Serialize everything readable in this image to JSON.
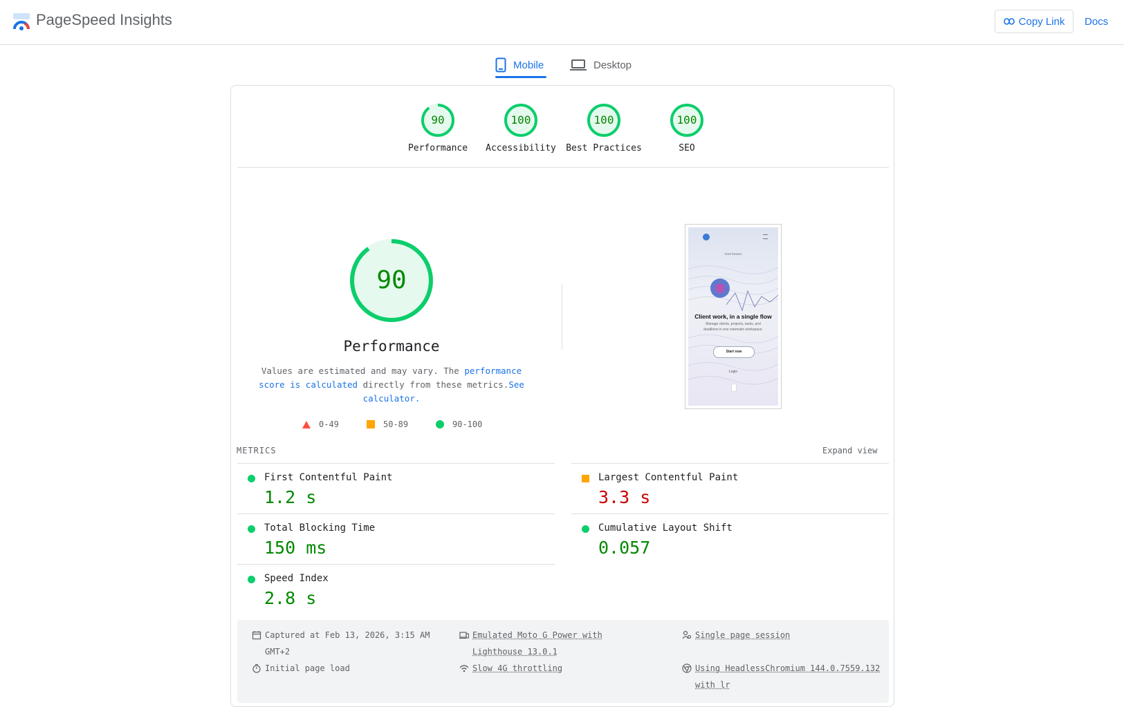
{
  "header": {
    "title": "PageSpeed Insights",
    "copy_link": "Copy Link",
    "docs": "Docs"
  },
  "tabs": [
    {
      "label": "Mobile",
      "selected": true
    },
    {
      "label": "Desktop",
      "selected": false
    }
  ],
  "category_scores": [
    {
      "label": "Performance",
      "score": "90"
    },
    {
      "label": "Accessibility",
      "score": "100"
    },
    {
      "label": "Best Practices",
      "score": "100"
    },
    {
      "label": "SEO",
      "score": "100"
    }
  ],
  "performance": {
    "score": "90",
    "title": "Performance",
    "desc_1": "Values are estimated and may vary. The ",
    "desc_link_1": "performance score is calculated",
    "desc_2": " directly from these metrics.",
    "desc_link_2": "See calculator."
  },
  "legend": [
    {
      "range": "0-49",
      "shape": "triangle",
      "color": "#ff4e42"
    },
    {
      "range": "50-89",
      "shape": "square",
      "color": "#ffa400"
    },
    {
      "range": "90-100",
      "shape": "circle",
      "color": "#0cce6b"
    }
  ],
  "screenshot": {
    "badge": "Free forever",
    "heading": "Client work, in a single flow",
    "subtext": "Manage clients, projects, tasks, and deadlines in one cinematic workspace.",
    "cta": "Start now",
    "login": "Login"
  },
  "metrics": {
    "label": "METRICS",
    "expand": "Expand view",
    "items": [
      {
        "name": "First Contentful Paint",
        "value": "1.2 s",
        "status": "good"
      },
      {
        "name": "Largest Contentful Paint",
        "value": "3.3 s",
        "status": "average"
      },
      {
        "name": "Total Blocking Time",
        "value": "150 ms",
        "status": "good"
      },
      {
        "name": "Cumulative Layout Shift",
        "value": "0.057",
        "status": "good"
      },
      {
        "name": "Speed Index",
        "value": "2.8 s",
        "status": "good"
      }
    ]
  },
  "run_info": {
    "captured": "Captured at Feb 13, 2026, 3:15 AM GMT+2",
    "initial_load": "Initial page load",
    "device": "Emulated Moto G Power with Lighthouse 13.0.1",
    "throttling": "Slow 4G throttling",
    "session": "Single page session",
    "browser": "Using HeadlessChromium 144.0.7559.132 with lr"
  },
  "colors": {
    "accent": "#1a73e8",
    "good": "#0cce6b",
    "good_text": "#008800",
    "average": "#ffa400",
    "poor_text": "#cc0000"
  },
  "icons": [
    "pagespeed-logo",
    "link-icon",
    "phone-icon",
    "laptop-icon",
    "calendar-icon",
    "timer-icon",
    "devices-icon",
    "wifi-icon",
    "people-icon",
    "chrome-icon"
  ]
}
